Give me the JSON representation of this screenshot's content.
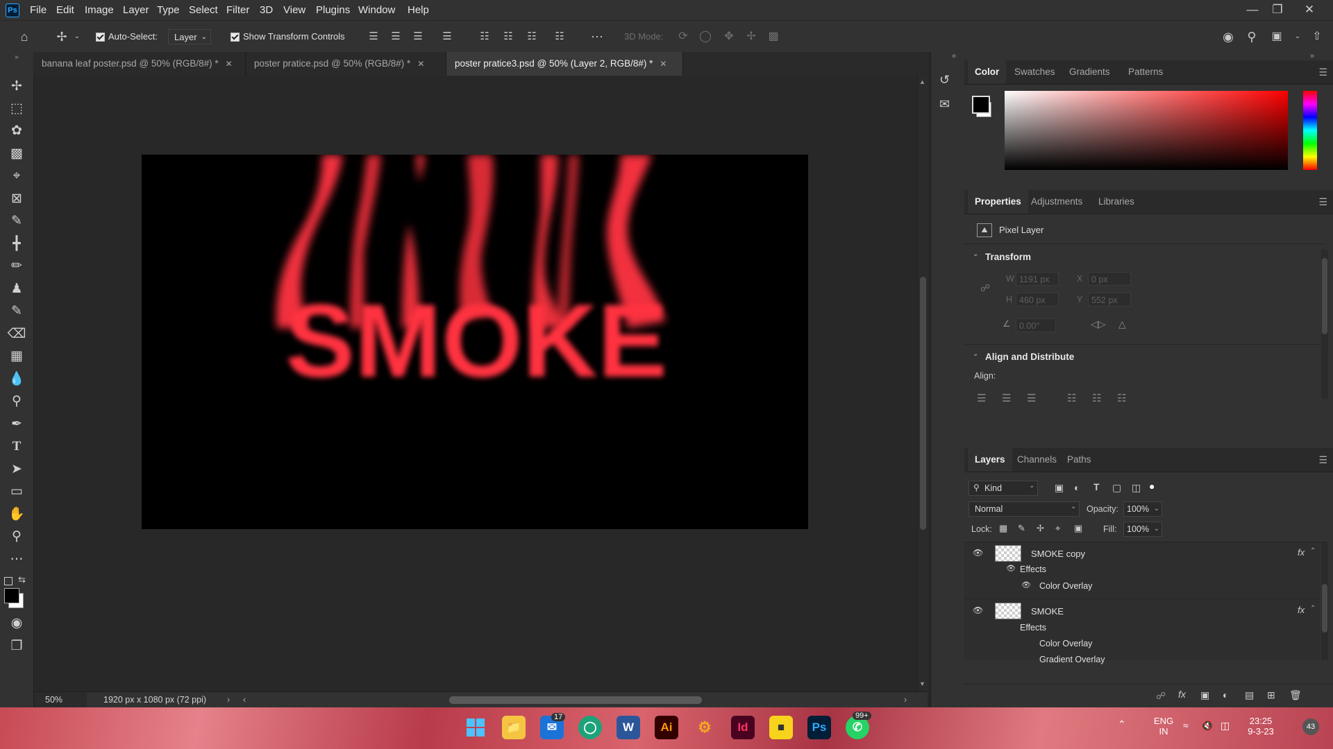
{
  "app": {
    "logo_text": "Ps"
  },
  "menu": [
    "File",
    "Edit",
    "Image",
    "Layer",
    "Type",
    "Select",
    "Filter",
    "3D",
    "View",
    "Plugins",
    "Window",
    "Help"
  ],
  "options_bar": {
    "auto_select_label": "Auto-Select:",
    "auto_select_checked": true,
    "layer_dropdown": "Layer",
    "show_transform_label": "Show Transform Controls",
    "show_transform_checked": true,
    "mode_label": "3D Mode:"
  },
  "tabs": [
    {
      "label": "banana leaf poster.psd @ 50% (RGB/8#) *",
      "active": false
    },
    {
      "label": "poster pratice.psd @ 50% (RGB/8#) *",
      "active": false
    },
    {
      "label": "poster pratice3.psd @ 50% (Layer 2, RGB/8#) *",
      "active": true
    }
  ],
  "canvas": {
    "text": "SMOKE",
    "text_color": "#ff3340",
    "background": "#000000"
  },
  "status": {
    "zoom": "50%",
    "doc_info": "1920 px x 1080 px (72 ppi)"
  },
  "color_panel": {
    "tabs": [
      "Color",
      "Swatches",
      "Gradients",
      "Patterns"
    ],
    "active": "Color",
    "foreground": "#000000",
    "background": "#ffffff",
    "hue_color": "#ff0000"
  },
  "properties_panel": {
    "tabs": [
      "Properties",
      "Adjustments",
      "Libraries"
    ],
    "active": "Properties",
    "layer_type": "Pixel Layer",
    "transform_title": "Transform",
    "w_label": "W",
    "w_value": "1191 px",
    "x_label": "X",
    "x_value": "0 px",
    "h_label": "H",
    "h_value": "460 px",
    "y_label": "Y",
    "y_value": "552 px",
    "angle_value": "0.00°",
    "align_title": "Align and Distribute",
    "align_label": "Align:"
  },
  "layers_panel": {
    "tabs": [
      "Layers",
      "Channels",
      "Paths"
    ],
    "active": "Layers",
    "kind_filter": "Kind",
    "blend_mode": "Normal",
    "opacity_label": "Opacity:",
    "opacity_value": "100%",
    "lock_label": "Lock:",
    "fill_label": "Fill:",
    "fill_value": "100%",
    "layers": [
      {
        "name": "SMOKE copy",
        "fx": "fx",
        "effects_label": "Effects",
        "effects": [
          "Color Overlay"
        ]
      },
      {
        "name": "SMOKE",
        "fx": "fx",
        "effects_label": "Effects",
        "effects": [
          "Color Overlay",
          "Gradient Overlay"
        ]
      }
    ]
  },
  "taskbar": {
    "mail_badge": "17",
    "whatsapp_badge": "99+",
    "language": "ENG",
    "region": "IN",
    "time": "23:25",
    "date": "9-3-23",
    "notifications": "43",
    "app_labels": {
      "illustrator": "Ai",
      "indesign": "Id",
      "photoshop": "Ps",
      "word": "W"
    }
  }
}
